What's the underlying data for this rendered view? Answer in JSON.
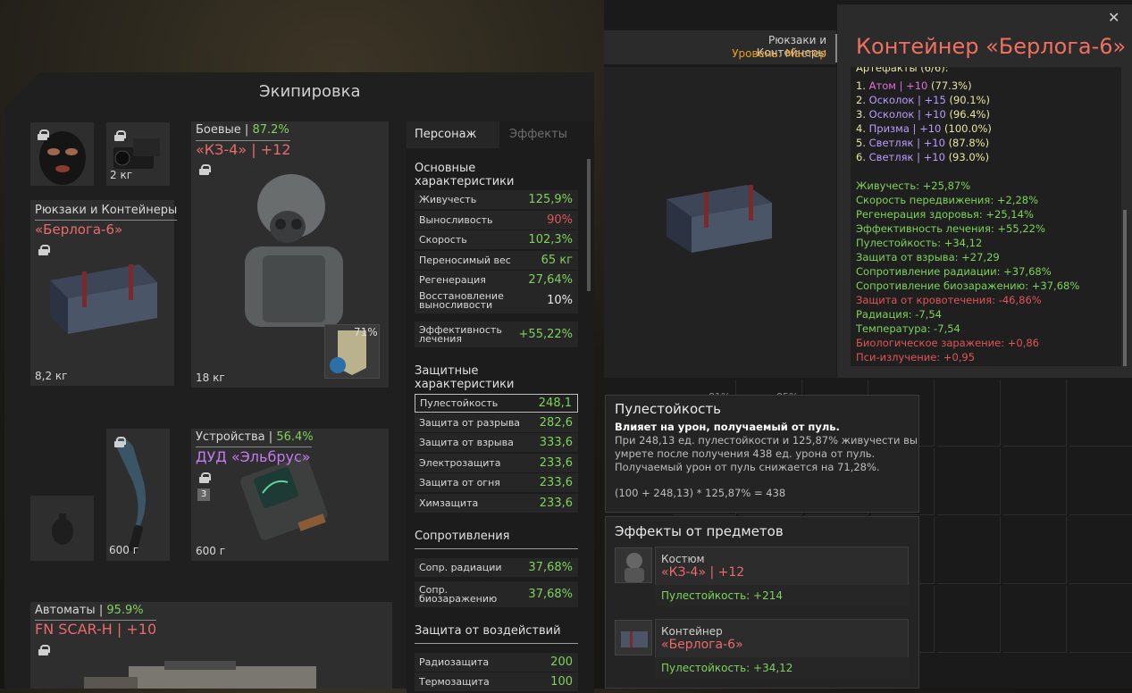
{
  "equipment": {
    "title": "Экипировка",
    "mask_slot": {
      "locked": true
    },
    "device_slot": {
      "weight": "2 кг"
    },
    "backpack": {
      "category": "Рюкзаки и Контейнеры",
      "name": "«Берлога-6»",
      "weight": "8,2 кг"
    },
    "armor": {
      "category": "Боевые |",
      "percent": "87.2%",
      "name": "«КЗ-4» | +12",
      "weight": "18 кг",
      "plate_percent": "71%"
    },
    "melee": {
      "weight": "600 г"
    },
    "detector": {
      "category": "Устройства |",
      "percent": "56.4%",
      "name": "ДУД «Эльбрус»",
      "badge": "3",
      "weight": "600 г"
    },
    "rifle": {
      "category": "Автоматы |",
      "percent": "95.9%",
      "name": "FN SCAR-H | +10"
    }
  },
  "stats": {
    "tabs": [
      "Персонаж",
      "Эффекты"
    ],
    "sections": {
      "main": "Основные характеристики",
      "protective": "Защитные характеристики",
      "resist": "Сопротивления",
      "exposure": "Защита от воздействий"
    },
    "main_rows": [
      {
        "label": "Живучесть",
        "value": "125,9%",
        "color": "#7ed35a"
      },
      {
        "label": "Выносливость",
        "value": "90%",
        "color": "#e05555"
      },
      {
        "label": "Скорость",
        "value": "102,3%",
        "color": "#7ed35a"
      },
      {
        "label": "Переносимый вес",
        "value": "65 кг",
        "color": "#7ed35a"
      },
      {
        "label": "Регенерация",
        "value": "27,64%",
        "color": "#7ed35a"
      },
      {
        "label": "Восстановление выносливости",
        "value": "10%",
        "color": "#e8e8e8"
      },
      {
        "label": "Эффективность лечения",
        "value": "+55,22%",
        "color": "#7ed35a"
      }
    ],
    "protective_rows": [
      {
        "label": "Пулестойкость",
        "value": "248,1"
      },
      {
        "label": "Защита от разрыва",
        "value": "282,6"
      },
      {
        "label": "Защита от взрыва",
        "value": "333,6"
      },
      {
        "label": "Электрозащита",
        "value": "233,6"
      },
      {
        "label": "Защита от огня",
        "value": "233,6"
      },
      {
        "label": "Химзащита",
        "value": "233,6"
      }
    ],
    "resist_rows": [
      {
        "label": "Сопр. радиации",
        "value": "37,68%"
      },
      {
        "label": "Сопр. биозаражению",
        "value": "37,68%"
      }
    ],
    "exposure_rows": [
      {
        "label": "Радиозащита",
        "value": "200"
      },
      {
        "label": "Термозащита",
        "value": "100"
      }
    ]
  },
  "tooltip": {
    "category": "Рюкзаки и Контейнеры",
    "level": "Уровень: Мастер",
    "title": "Контейнер «Берлога-6»",
    "artifacts_header": "Артефакты (6/6):",
    "artifacts": [
      {
        "num": "1.",
        "name": "Атом",
        "rest": " | +10 ",
        "pct": "(77.3%)",
        "color": "#e070d8"
      },
      {
        "num": "2.",
        "name": "Осколок",
        "rest": " | +15 ",
        "pct": "(90.1%)",
        "color": "#b89cff"
      },
      {
        "num": "3.",
        "name": "Осколок",
        "rest": " | +10 ",
        "pct": "(96.4%)",
        "color": "#b89cff"
      },
      {
        "num": "4.",
        "name": "Призма",
        "rest": " | +10 ",
        "pct": "(100.0%)",
        "color": "#b89cff"
      },
      {
        "num": "5.",
        "name": "Светляк",
        "rest": " | +10 ",
        "pct": "(87.8%)",
        "color": "#b89cff"
      },
      {
        "num": "6.",
        "name": "Светляк",
        "rest": " | +10 ",
        "pct": "(93.0%)",
        "color": "#b89cff"
      }
    ],
    "effects": [
      {
        "text": "Живучесть: +25,87%",
        "color": "#7ed35a"
      },
      {
        "text": "Скорость передвижения: +2,28%",
        "color": "#7ed35a"
      },
      {
        "text": "Регенерация здоровья: +25,14%",
        "color": "#7ed35a"
      },
      {
        "text": "Эффективность лечения: +55,22%",
        "color": "#7ed35a"
      },
      {
        "text": "Пулестойкость: +34,12",
        "color": "#7ed35a"
      },
      {
        "text": "Защита от взрыва: +27,29",
        "color": "#7ed35a"
      },
      {
        "text": "Сопротивление радиации: +37,68%",
        "color": "#7ed35a"
      },
      {
        "text": "Сопротивление биозаражению: +37,68%",
        "color": "#7ed35a"
      },
      {
        "text": "Защита от кровотечения: -46,86%",
        "color": "#e05555"
      },
      {
        "text": "Радиация: -7,54",
        "color": "#7ed35a"
      },
      {
        "text": "Температура: -7,54",
        "color": "#7ed35a"
      },
      {
        "text": "Биологическое заражение: +0,86",
        "color": "#e05555"
      },
      {
        "text": "Пси-излучение: +0,95",
        "color": "#e05555"
      }
    ]
  },
  "bullet_info": {
    "title": "Пулестойкость",
    "subtitle": "Влияет на урон, получаемый от пуль.",
    "lines": [
      "При 248,13 ед. пулестойкости и 125,87% живучести вы",
      "умрете после получения 438 ед. урона от пуль.",
      "Получаемый урон от пуль снижается на 71,28%."
    ],
    "formula": "(100 + 248,13) * 125,87% = 438"
  },
  "item_effects": {
    "title": "Эффекты от предметов",
    "items": [
      {
        "type": "Костюм",
        "name": "«КЗ-4» | +12",
        "effect": "Пулестойкость: +214",
        "name_color": "#e76b6b"
      },
      {
        "type": "Контейнер",
        "name": "«Берлога-6»",
        "effect": "Пулестойкость: +34,12",
        "name_color": "#e76b6b"
      }
    ]
  },
  "inventory": {
    "partial_labels": [
      "81%",
      "85%"
    ]
  }
}
